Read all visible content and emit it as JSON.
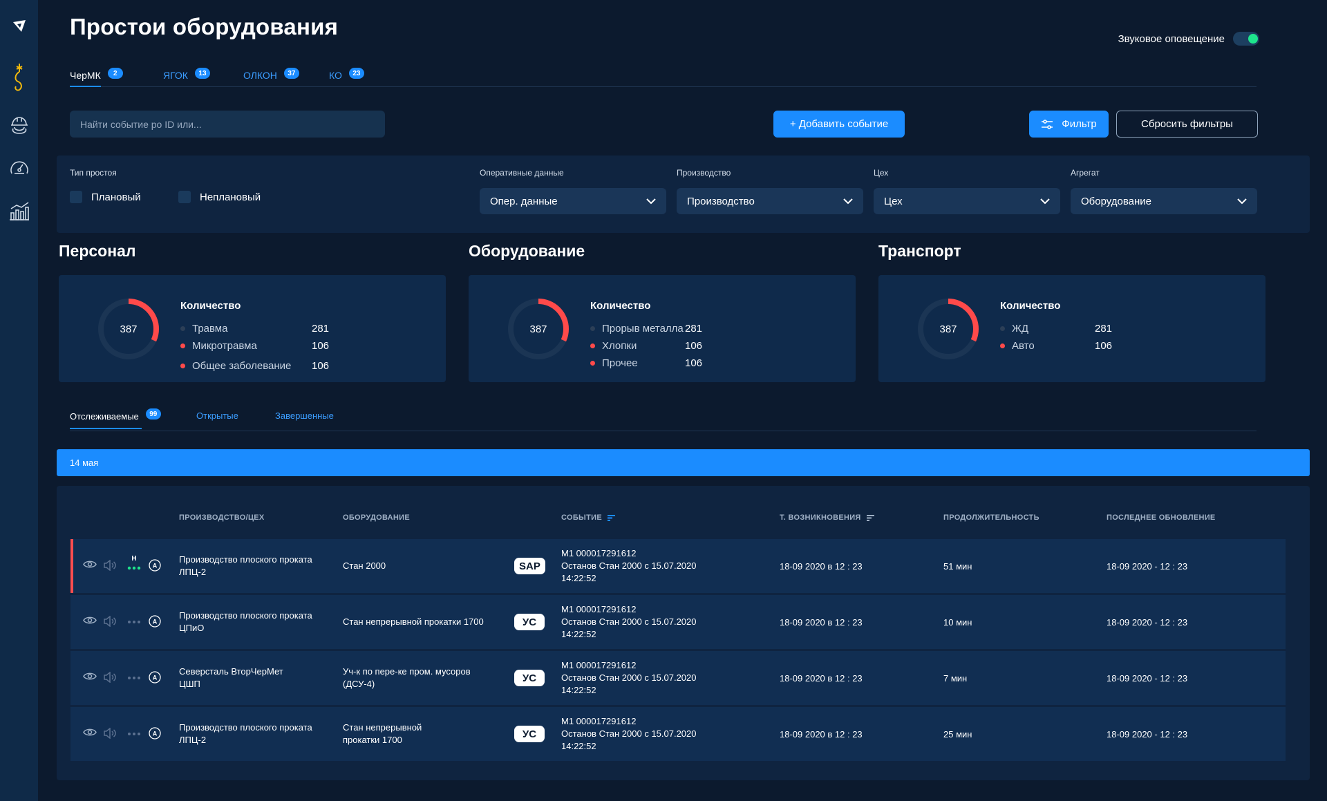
{
  "page": {
    "title": "Простои оборудования"
  },
  "sound": {
    "label": "Звуковое оповещение",
    "enabled": true
  },
  "tabs": [
    {
      "label": "ЧерМК",
      "count": "2",
      "active": true
    },
    {
      "label": "ЯГОК",
      "count": "13"
    },
    {
      "label": "ОЛКОН",
      "count": "37"
    },
    {
      "label": "КО",
      "count": "23"
    }
  ],
  "search": {
    "placeholder": "Найти событие ро ID или..."
  },
  "buttons": {
    "add": "+ Добавить событие",
    "filter": "Фильтр",
    "reset": "Сбросить фильтры"
  },
  "filters": {
    "downtime_type_label": "Тип простоя",
    "planned": "Плановый",
    "unplanned": "Неплановый",
    "oper_label": "Оперативные данные",
    "oper_value": "Опер. данные",
    "prod_label": "Производство",
    "prod_value": "Производство",
    "shop_label": "Цех",
    "shop_value": "Цех",
    "unit_label": "Агрегат",
    "unit_value": "Оборудование"
  },
  "summary": [
    {
      "title": "Персонал",
      "total": "387",
      "head": "Количество",
      "items": [
        {
          "label": "Травма",
          "value": "281",
          "color": "#2c3f57"
        },
        {
          "label": "Микротравма",
          "value": "106",
          "color": "#ff4a4a"
        },
        {
          "label": "Общее заболевание",
          "value": "106",
          "color": "#ff4a4a"
        }
      ]
    },
    {
      "title": "Оборудование",
      "total": "387",
      "head": "Количество",
      "items": [
        {
          "label": "Прорыв металла",
          "value": "281",
          "color": "#2c3f57"
        },
        {
          "label": "Хлопки",
          "value": "106",
          "color": "#ff4a4a"
        },
        {
          "label": "Прочее",
          "value": "106",
          "color": "#ff4a4a"
        }
      ]
    },
    {
      "title": "Транспорт",
      "total": "387",
      "head": "Количество",
      "items": [
        {
          "label": "ЖД",
          "value": "281",
          "color": "#2c3f57"
        },
        {
          "label": "Авто",
          "value": "106",
          "color": "#ff4a4a"
        }
      ]
    }
  ],
  "event_tabs": [
    {
      "label": "Отслеживаемые",
      "count": "99",
      "active": true
    },
    {
      "label": "Открытые"
    },
    {
      "label": "Завершенные"
    }
  ],
  "date_group": "14 мая",
  "table": {
    "columns": [
      "ПРОИЗВОДСТВО/ЦЕХ",
      "ОБОРУДОВАНИЕ",
      "СОБЫТИЕ",
      "Т. ВОЗНИКНОВЕНИЯ",
      "ПРОДОЛЖИТЕЛЬНОСТЬ",
      "ПОСЛЕДНЕЕ ОБНОВЛЕНИЕ"
    ],
    "rows": [
      {
        "alert": true,
        "status_letter": "Н",
        "prod": "Производство плоского проката",
        "shop": "ЛПЦ-2",
        "equip": "Стан 2000",
        "equip2": "",
        "tag": "SAP",
        "ev1": "М1 000017291612",
        "ev2": "Останов Стан 2000 с 15.07.2020",
        "ev3": "14:22:52",
        "time": "18-09 2020 в 12 : 23",
        "dur": "51 мин",
        "upd": "18-09 2020 - 12 : 23"
      },
      {
        "alert": false,
        "status_letter": "",
        "prod": "Производство плоского проката",
        "shop": "ЦПиО",
        "equip": "Стан непрерывной прокатки 1700",
        "equip2": "",
        "tag": "УС",
        "ev1": "М1 000017291612",
        "ev2": "Останов Стан 2000 с 15.07.2020",
        "ev3": "14:22:52",
        "time": "18-09 2020 в 12 : 23",
        "dur": "10 мин",
        "upd": "18-09 2020 - 12 : 23"
      },
      {
        "alert": false,
        "status_letter": "",
        "prod": "Северсталь ВторЧерМет",
        "shop": "ЦШП",
        "equip": "Уч-к по пере-ке пром. мусоров",
        "equip2": "(ДСУ-4)",
        "tag": "УС",
        "ev1": "М1 000017291612",
        "ev2": "Останов Стан 2000 с 15.07.2020",
        "ev3": "14:22:52",
        "time": "18-09 2020 в 12 : 23",
        "dur": "7 мин",
        "upd": "18-09 2020 - 12 : 23"
      },
      {
        "alert": false,
        "status_letter": "",
        "prod": "Производство плоского проката",
        "shop": "ЛПЦ-2",
        "equip": "Стан непрерывной",
        "equip2": "прокатки 1700",
        "tag": "УС",
        "ev1": "М1 000017291612",
        "ev2": "Останов Стан 2000 с 15.07.2020",
        "ev3": "14:22:52",
        "time": "18-09 2020 в 12 : 23",
        "dur": "25 мин",
        "upd": "18-09 2020 - 12 : 23"
      }
    ]
  },
  "colors": {
    "accent": "#1b8cff",
    "alert": "#ff4a4a",
    "ok": "#1ee58c",
    "background": "#0c1a2e",
    "panel": "#0f2440"
  }
}
